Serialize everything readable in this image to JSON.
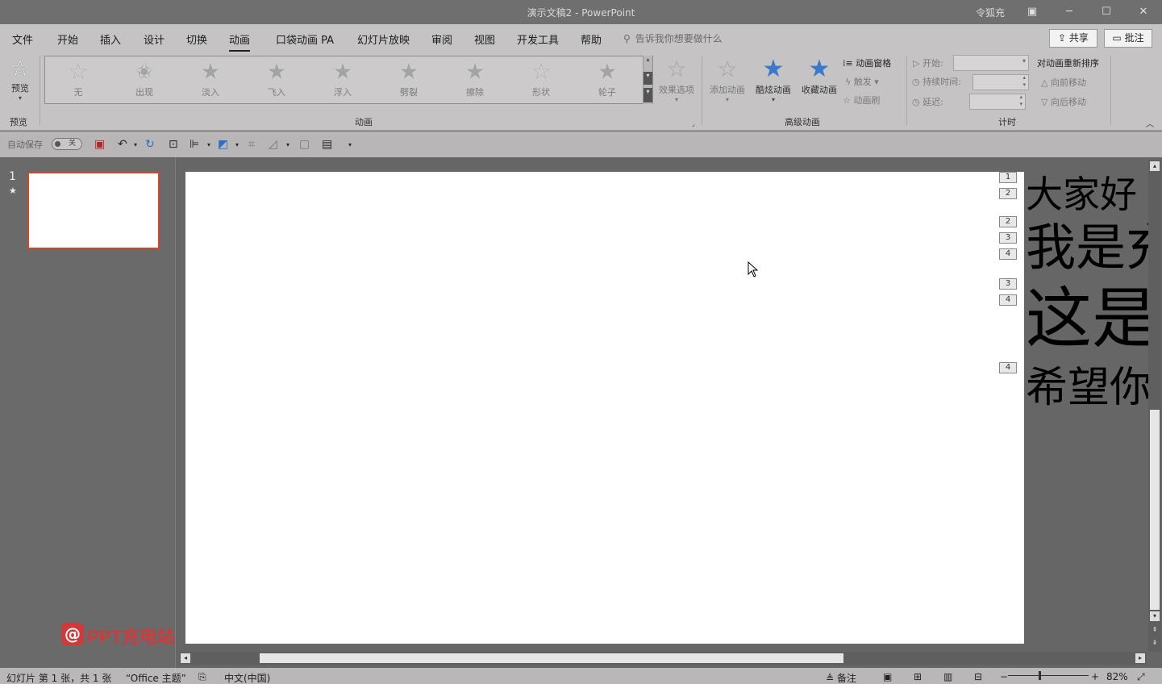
{
  "titlebar": {
    "title": "演示文稿2 - PowerPoint",
    "user": "令狐充",
    "icon_ribbon": "ribbon-options-icon",
    "minimize": "─",
    "maximize": "☐",
    "close": "✕"
  },
  "tabs": [
    {
      "label": "文件"
    },
    {
      "label": "开始"
    },
    {
      "label": "插入"
    },
    {
      "label": "设计"
    },
    {
      "label": "切换"
    },
    {
      "label": "动画"
    },
    {
      "label": "口袋动画 PA"
    },
    {
      "label": "幻灯片放映"
    },
    {
      "label": "审阅"
    },
    {
      "label": "视图"
    },
    {
      "label": "开发工具"
    },
    {
      "label": "帮助"
    }
  ],
  "active_tab": "动画",
  "search": {
    "placeholder": "告诉我你想要做什么"
  },
  "share": {
    "label": "共享"
  },
  "comment": {
    "label": "批注"
  },
  "ribbon": {
    "preview": {
      "label": "预览",
      "group": "预览"
    },
    "animations": {
      "group": "动画",
      "items": [
        {
          "label": "无"
        },
        {
          "label": "出现"
        },
        {
          "label": "淡入"
        },
        {
          "label": "飞入"
        },
        {
          "label": "浮入"
        },
        {
          "label": "劈裂"
        },
        {
          "label": "擦除"
        },
        {
          "label": "形状"
        },
        {
          "label": "轮子"
        }
      ],
      "effect_options": "效果选项"
    },
    "advanced": {
      "group": "高级动画",
      "add_animation": "添加动画",
      "cool_animation": "酷炫动画",
      "favorite_animation": "收藏动画",
      "animation_pane": "动画窗格",
      "trigger": "触发",
      "animation_painter": "动画刷"
    },
    "timing": {
      "group": "计时",
      "start": "开始:",
      "duration": "持续时间:",
      "delay": "延迟:",
      "reorder_title": "对动画重新排序",
      "move_earlier": "向前移动",
      "move_later": "向后移动"
    }
  },
  "qat": {
    "autosave_label": "自动保存",
    "autosave_state": "关"
  },
  "slides_pane": {
    "slide_number": "1",
    "has_animation_mark": "★"
  },
  "animation_tags": [
    "1",
    "2",
    "2",
    "3",
    "4",
    "3",
    "4",
    "4"
  ],
  "offslide_text": [
    "大家好",
    "我是充",
    "这是",
    "希望你"
  ],
  "watermark": "PPT充电站",
  "statusbar": {
    "slide_info": "幻灯片 第 1 张，共 1 张",
    "theme": "“Office 主题”",
    "language": "中文(中国)",
    "notes": "备注",
    "zoom": "82%"
  },
  "colors": {
    "accent": "#d24726",
    "ribbon_bg": "#c5c3c3",
    "workspace_bg": "#666666",
    "star_blue": "#3a78c9"
  }
}
